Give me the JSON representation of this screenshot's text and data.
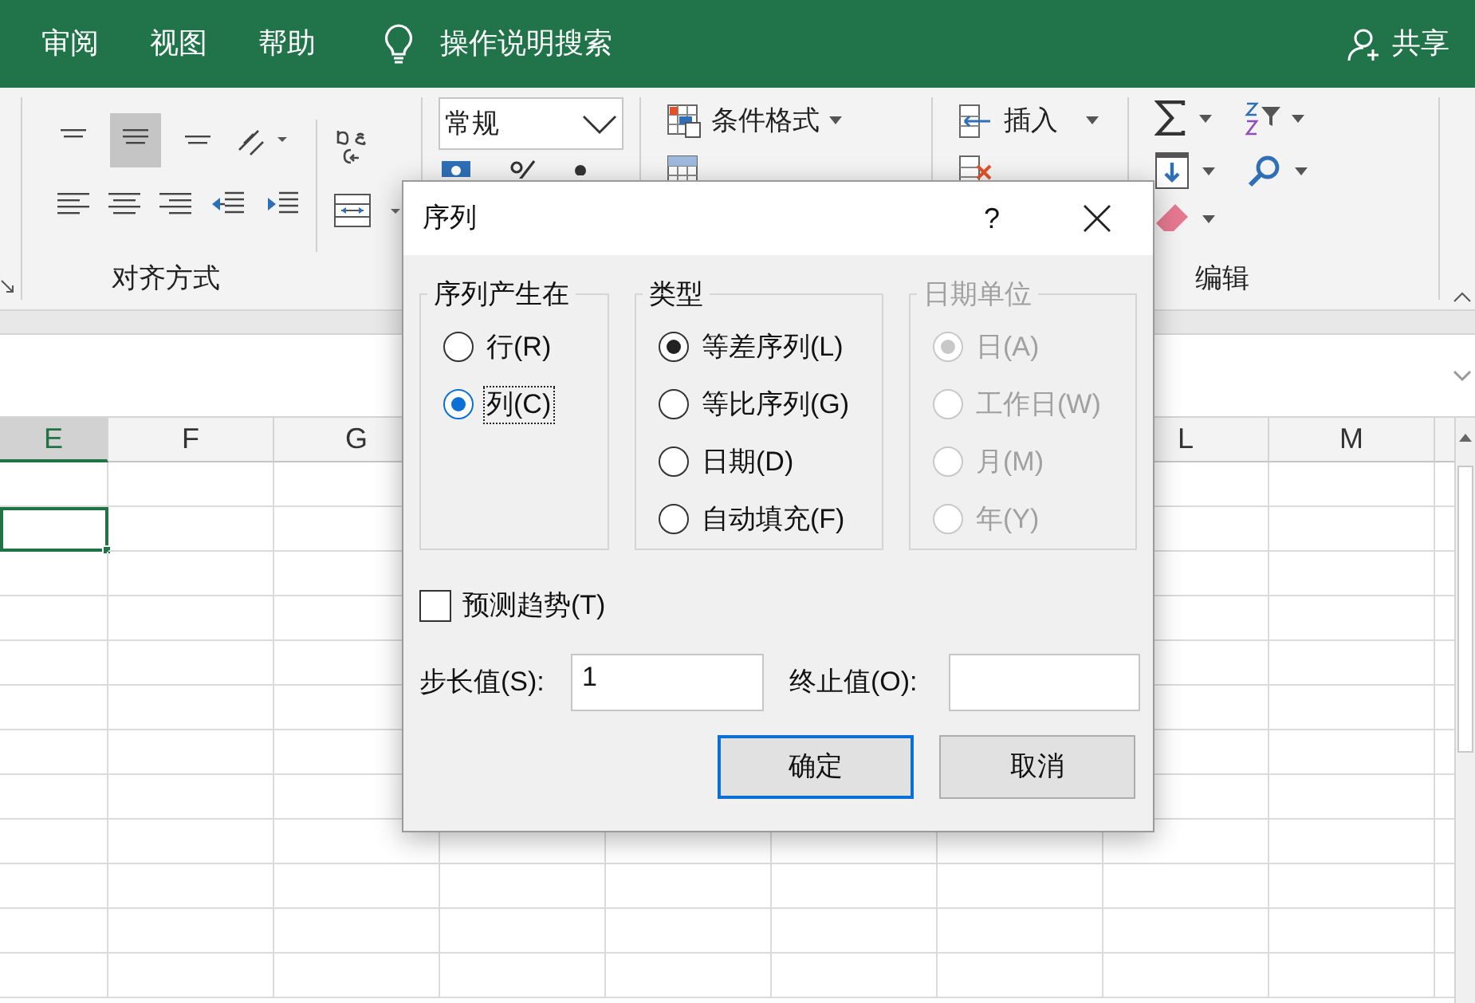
{
  "ribbon_tabs": [
    {
      "label": "审阅"
    },
    {
      "label": "视图"
    },
    {
      "label": "帮助"
    }
  ],
  "tell_me": "操作说明搜索",
  "share": "共享",
  "ribbon": {
    "number_format": "常规",
    "styles": [
      "条件格式"
    ],
    "cells": [
      "插入"
    ],
    "alignment_label": "对齐方式",
    "editing_label": "编辑"
  },
  "columns_left": [
    {
      "label": "E",
      "selected": true
    },
    {
      "label": "F",
      "selected": false
    },
    {
      "label": "G",
      "selected": false
    }
  ],
  "columns_right": [
    {
      "label": "L",
      "selected": false
    },
    {
      "label": "M",
      "selected": false
    }
  ],
  "dialog": {
    "title": "序列",
    "help": "?",
    "groups": [
      {
        "title": "序列产生在",
        "disabled": false,
        "options": [
          {
            "label": "行(R)",
            "selected": false,
            "focused": false
          },
          {
            "label": "列(C)",
            "selected": true,
            "focused": true
          }
        ]
      },
      {
        "title": "类型",
        "disabled": false,
        "options": [
          {
            "label": "等差序列(L)",
            "selected": true,
            "focused": false
          },
          {
            "label": "等比序列(G)",
            "selected": false,
            "focused": false
          },
          {
            "label": "日期(D)",
            "selected": false,
            "focused": false
          },
          {
            "label": "自动填充(F)",
            "selected": false,
            "focused": false
          }
        ]
      },
      {
        "title": "日期单位",
        "disabled": true,
        "options": [
          {
            "label": "日(A)",
            "selected": true,
            "focused": false
          },
          {
            "label": "工作日(W)",
            "selected": false,
            "focused": false
          },
          {
            "label": "月(M)",
            "selected": false,
            "focused": false
          },
          {
            "label": "年(Y)",
            "selected": false,
            "focused": false
          }
        ]
      }
    ],
    "trend": {
      "label": "预测趋势(T)",
      "checked": false
    },
    "step": {
      "label": "步长值(S):",
      "value": "1"
    },
    "stop": {
      "label": "终止值(O):"
    },
    "buttons": [
      {
        "label": "确定",
        "default": true
      },
      {
        "label": "取消",
        "default": false
      }
    ]
  }
}
